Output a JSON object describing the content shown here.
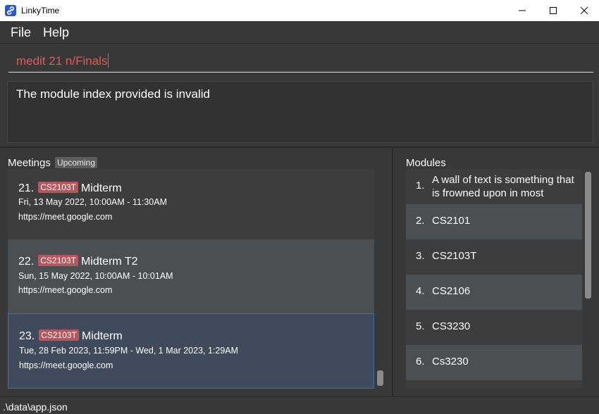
{
  "window": {
    "title": "LinkyTime"
  },
  "menu": {
    "file": "File",
    "help": "Help"
  },
  "command": {
    "value": "medit 21 n/Finals"
  },
  "result": {
    "message": "The module index provided is invalid"
  },
  "meetings": {
    "title": "Meetings",
    "badge": "Upcoming",
    "items": [
      {
        "index": "21.",
        "tag": "CS2103T",
        "name": "Midterm",
        "time": "Fri, 13 May 2022, 10:00AM  -  11:30AM",
        "link": "https://meet.google.com"
      },
      {
        "index": "22.",
        "tag": "CS2103T",
        "name": "Midterm T2",
        "time": "Sun, 15 May 2022, 10:00AM  -  10:01AM",
        "link": "https://meet.google.com"
      },
      {
        "index": "23.",
        "tag": "CS2103T",
        "name": "Midterm",
        "time": "Tue, 28 Feb 2023, 11:59PM  -  Wed, 1 Mar 2023, 1:29AM",
        "link": "https://meet.google.com"
      }
    ]
  },
  "modules": {
    "title": "Modules",
    "items": [
      {
        "index": "1.",
        "name": "A wall of text is something that is frowned upon in most"
      },
      {
        "index": "2.",
        "name": "CS2101"
      },
      {
        "index": "3.",
        "name": "CS2103T"
      },
      {
        "index": "4.",
        "name": "CS2106"
      },
      {
        "index": "5.",
        "name": "CS3230"
      },
      {
        "index": "6.",
        "name": "Cs3230"
      }
    ]
  },
  "status": {
    "path": ".\\data\\app.json"
  },
  "colors": {
    "tag": "#b6575f",
    "command_text": "#e25b5b",
    "selected_border": "#3e6fa4",
    "app_icon": "#2a56d6"
  },
  "icons": [
    "link-app-icon",
    "minimize-icon",
    "maximize-icon",
    "close-icon"
  ]
}
